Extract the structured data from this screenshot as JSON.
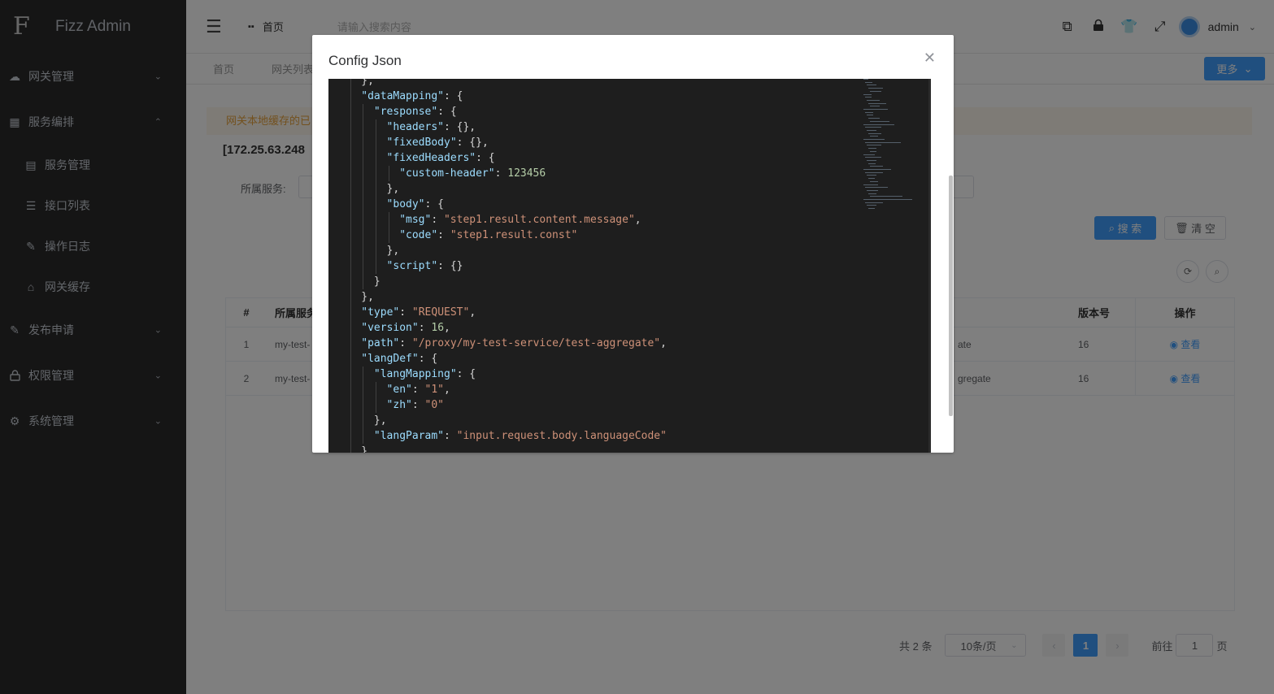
{
  "app": {
    "title": "Fizz Admin",
    "logo_glyph": "F"
  },
  "sidebar": {
    "items": [
      {
        "label": "网关管理",
        "icon": "cloud-icon",
        "glyph": "☁",
        "arrow": "⌄"
      },
      {
        "label": "服务编排",
        "icon": "grid-icon",
        "glyph": "▦",
        "arrow": "⌃"
      },
      {
        "label": "发布申请",
        "icon": "edit-icon",
        "glyph": "✎",
        "arrow": "⌄"
      },
      {
        "label": "权限管理",
        "icon": "lock-icon",
        "glyph": "🔒",
        "arrow": "⌄"
      },
      {
        "label": "系统管理",
        "icon": "gear-icon",
        "glyph": "⚙",
        "arrow": "⌄"
      }
    ],
    "subitems": [
      {
        "label": "服务管理",
        "icon": "server-icon",
        "glyph": "▤"
      },
      {
        "label": "接口列表",
        "icon": "list-icon",
        "glyph": "☰"
      },
      {
        "label": "操作日志",
        "icon": "log-icon",
        "glyph": "✎"
      },
      {
        "label": "网关缓存",
        "icon": "cache-icon",
        "glyph": "⌂"
      }
    ]
  },
  "navbar": {
    "home": "首页",
    "search_placeholder": "请输入搜索内容",
    "user": "admin"
  },
  "tags": {
    "home": "首页",
    "gateway_list": "网关列表",
    "more": "更多"
  },
  "content": {
    "alert": "网关本地缓存的已",
    "ip_title": "[172.25.63.248",
    "service_label": "所属服务:",
    "search_btn": "搜 索",
    "clear_btn": "清 空"
  },
  "table": {
    "headers": {
      "idx": "#",
      "service": "所属服务",
      "version": "版本号",
      "ops": "操作"
    },
    "rows": [
      {
        "idx": "1",
        "service": "my-test-",
        "path": "ate",
        "version": "16",
        "op": "查看"
      },
      {
        "idx": "2",
        "service": "my-test-",
        "path": "gregate",
        "version": "16",
        "op": "查看"
      }
    ]
  },
  "pager": {
    "total": "共 2 条",
    "page_size": "10条/页",
    "current": "1",
    "goto": "前往",
    "goto_value": "1",
    "page_suffix": "页"
  },
  "dialog": {
    "title": "Config Json",
    "code_lines": [
      {
        "indent": 2,
        "parts": [
          [
            "p",
            "},"
          ]
        ]
      },
      {
        "indent": 2,
        "parts": [
          [
            "k",
            "\"dataMapping\""
          ],
          [
            "p",
            ": {"
          ]
        ]
      },
      {
        "indent": 3,
        "parts": [
          [
            "k",
            "\"response\""
          ],
          [
            "p",
            ": {"
          ]
        ]
      },
      {
        "indent": 4,
        "parts": [
          [
            "k",
            "\"headers\""
          ],
          [
            "p",
            ": {},"
          ]
        ]
      },
      {
        "indent": 4,
        "parts": [
          [
            "k",
            "\"fixedBody\""
          ],
          [
            "p",
            ": {},"
          ]
        ]
      },
      {
        "indent": 4,
        "parts": [
          [
            "k",
            "\"fixedHeaders\""
          ],
          [
            "p",
            ": {"
          ]
        ]
      },
      {
        "indent": 5,
        "parts": [
          [
            "k",
            "\"custom-header\""
          ],
          [
            "p",
            ": "
          ],
          [
            "n",
            "123456"
          ]
        ]
      },
      {
        "indent": 4,
        "parts": [
          [
            "p",
            "},"
          ]
        ]
      },
      {
        "indent": 4,
        "parts": [
          [
            "k",
            "\"body\""
          ],
          [
            "p",
            ": {"
          ]
        ]
      },
      {
        "indent": 5,
        "parts": [
          [
            "k",
            "\"msg\""
          ],
          [
            "p",
            ": "
          ],
          [
            "s",
            "\"step1.result.content.message\""
          ],
          [
            "p",
            ","
          ]
        ]
      },
      {
        "indent": 5,
        "parts": [
          [
            "k",
            "\"code\""
          ],
          [
            "p",
            ": "
          ],
          [
            "s",
            "\"step1.result.const\""
          ]
        ]
      },
      {
        "indent": 4,
        "parts": [
          [
            "p",
            "},"
          ]
        ]
      },
      {
        "indent": 4,
        "parts": [
          [
            "k",
            "\"script\""
          ],
          [
            "p",
            ": {}"
          ]
        ]
      },
      {
        "indent": 3,
        "parts": [
          [
            "p",
            "}"
          ]
        ]
      },
      {
        "indent": 2,
        "parts": [
          [
            "p",
            "},"
          ]
        ]
      },
      {
        "indent": 2,
        "parts": [
          [
            "k",
            "\"type\""
          ],
          [
            "p",
            ": "
          ],
          [
            "s",
            "\"REQUEST\""
          ],
          [
            "p",
            ","
          ]
        ]
      },
      {
        "indent": 2,
        "parts": [
          [
            "k",
            "\"version\""
          ],
          [
            "p",
            ": "
          ],
          [
            "n",
            "16"
          ],
          [
            "p",
            ","
          ]
        ]
      },
      {
        "indent": 2,
        "parts": [
          [
            "k",
            "\"path\""
          ],
          [
            "p",
            ": "
          ],
          [
            "s",
            "\"/proxy/my-test-service/test-aggregate\""
          ],
          [
            "p",
            ","
          ]
        ]
      },
      {
        "indent": 2,
        "parts": [
          [
            "k",
            "\"langDef\""
          ],
          [
            "p",
            ": {"
          ]
        ]
      },
      {
        "indent": 3,
        "parts": [
          [
            "k",
            "\"langMapping\""
          ],
          [
            "p",
            ": {"
          ]
        ]
      },
      {
        "indent": 4,
        "parts": [
          [
            "k",
            "\"en\""
          ],
          [
            "p",
            ": "
          ],
          [
            "s",
            "\"1\""
          ],
          [
            "p",
            ","
          ]
        ]
      },
      {
        "indent": 4,
        "parts": [
          [
            "k",
            "\"zh\""
          ],
          [
            "p",
            ": "
          ],
          [
            "s",
            "\"0\""
          ]
        ]
      },
      {
        "indent": 3,
        "parts": [
          [
            "p",
            "},"
          ]
        ]
      },
      {
        "indent": 3,
        "parts": [
          [
            "k",
            "\"langParam\""
          ],
          [
            "p",
            ": "
          ],
          [
            "s",
            "\"input.request.body.languageCode\""
          ]
        ]
      },
      {
        "indent": 2,
        "parts": [
          [
            "p",
            "}"
          ]
        ]
      }
    ]
  }
}
